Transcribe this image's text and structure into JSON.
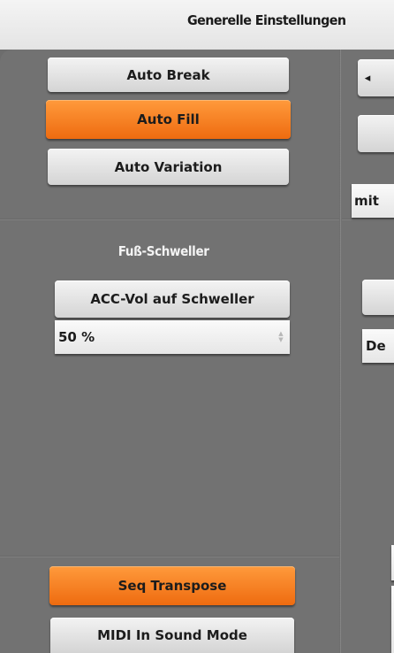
{
  "header": {
    "title": "Generelle Einstellungen"
  },
  "left_column": {
    "auto_break": "Auto Break",
    "auto_fill": "Auto Fill",
    "auto_variation": "Auto Variation",
    "fuss_schweller_title": "Fuß-Schweller",
    "acc_vol_button": "ACC-Vol auf Schweller",
    "acc_vol_value": "50 %",
    "seq_transpose": "Seq Transpose",
    "midi_in_sound_mode": "MIDI In Sound Mode"
  },
  "right_column": {
    "arrow_glyph": "◂",
    "select_1_value": "mit",
    "select_2_value": "De"
  },
  "colors": {
    "accent_orange": "#f27a1e",
    "panel_gray": "#727272",
    "button_gray": "#e0e0e0"
  },
  "icons": [
    "left-arrow-icon",
    "stepper-icon"
  ]
}
